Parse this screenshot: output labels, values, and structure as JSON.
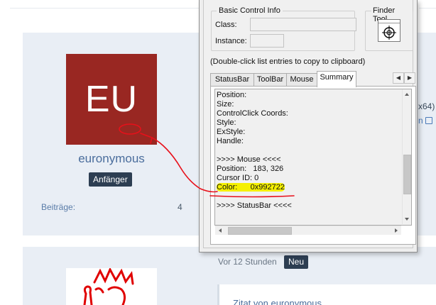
{
  "forum": {
    "avatar_initials": "EU",
    "avatar_color": "#992722",
    "username": "euronymous",
    "rank": "Anfänger",
    "stat_label": "Beiträge:",
    "stat_value": "4",
    "side_text_1": "x64)",
    "side_text_2": "n",
    "post_time": "Vor 12 Stunden",
    "new_badge": "Neu",
    "quote_author": "Zitat von euronymous"
  },
  "window_info": {
    "basic_group_title": "Basic Control Info",
    "class_label": "Class:",
    "class_value": "",
    "instance_label": "Instance:",
    "instance_value": "",
    "finder_group_title": "Finder Tool",
    "finder_icon": "crosshair-icon",
    "hint": "(Double-click list entries to copy to clipboard)",
    "tabs": [
      {
        "label": "StatusBar",
        "active": false
      },
      {
        "label": "ToolBar",
        "active": false
      },
      {
        "label": "Mouse",
        "active": false
      },
      {
        "label": "Summary",
        "active": true
      }
    ],
    "summary_lines": [
      "Position:",
      "Size:",
      "ControlClick Coords:",
      "Style:",
      "ExStyle:",
      "Handle:",
      "",
      ">>>> Mouse <<<<",
      "Position:   183, 326",
      "Cursor ID: 0",
      "Color:      0x992722",
      "",
      ">>>> StatusBar <<<<"
    ],
    "highlight_color": "#f5f000"
  }
}
